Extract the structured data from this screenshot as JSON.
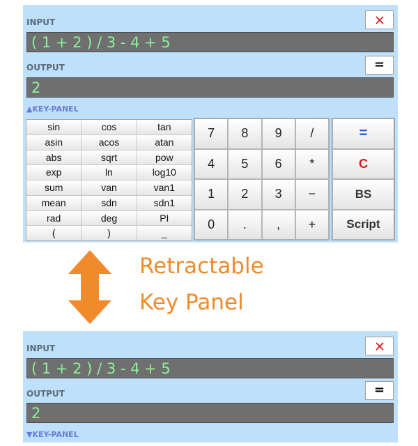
{
  "top_panel": {
    "input_label": "INPUT",
    "input_value": "( 1 + 2 ) / 3 - 4 + 5",
    "output_label": "OUTPUT",
    "output_value": "2",
    "equals_label": "=",
    "key_panel_toggle": "▲KEY-PANEL",
    "function_keys": [
      "sin",
      "cos",
      "tan",
      "asin",
      "acos",
      "atan",
      "abs",
      "sqrt",
      "pow",
      "exp",
      "ln",
      "log10",
      "sum",
      "van",
      "van1",
      "mean",
      "sdn",
      "sdn1",
      "rad",
      "deg",
      "PI",
      "(",
      ")",
      "_"
    ],
    "numeric_keys": [
      "7",
      "8",
      "9",
      "/",
      "4",
      "5",
      "6",
      "*",
      "1",
      "2",
      "3",
      "−",
      "0",
      ".",
      ",",
      "+"
    ],
    "control_keys": [
      "=",
      "C",
      "BS",
      "Script"
    ]
  },
  "caption": {
    "line1": "Retractable",
    "line2": "Key Panel"
  },
  "bottom_panel": {
    "input_label": "INPUT",
    "input_value": "( 1 + 2 ) / 3 - 4 + 5",
    "output_label": "OUTPUT",
    "output_value": "2",
    "equals_label": "=",
    "key_panel_toggle": "▼KEY-PANEL"
  },
  "colors": {
    "panel_bg": "#bfe0fb",
    "display_bg": "#6f6f6f",
    "display_text": "#8df19a",
    "caption": "#f08a2a",
    "close_icon": "#d31e1e"
  },
  "icons": [
    "close-icon",
    "double-arrow-icon"
  ]
}
